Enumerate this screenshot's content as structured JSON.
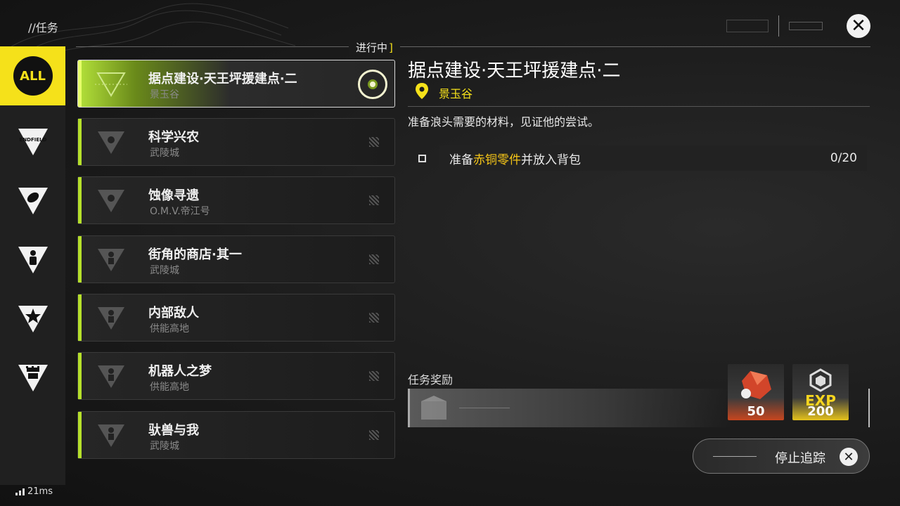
{
  "header": {
    "title": "//任务",
    "close_icon": "close-icon"
  },
  "status": {
    "label": "进行中",
    "bracket": "]"
  },
  "sidebar": {
    "items": [
      {
        "label": "ALL",
        "icon": "all-icon",
        "active": true
      },
      {
        "label": "ENDFIELD",
        "icon": "endfield-triangle-icon",
        "active": false
      },
      {
        "label": "",
        "icon": "leaf-triangle-icon",
        "active": false
      },
      {
        "label": "",
        "icon": "person-triangle-icon",
        "active": false
      },
      {
        "label": "",
        "icon": "star-triangle-icon",
        "active": false
      },
      {
        "label": "",
        "icon": "gear-triangle-icon",
        "active": false
      }
    ]
  },
  "quests": [
    {
      "name": "据点建设·天王坪援建点·二",
      "location": "景玉谷",
      "active": true
    },
    {
      "name": "科学兴农",
      "location": "武陵城",
      "active": false
    },
    {
      "name": "蚀像寻遗",
      "location": "O.M.V.帝江号",
      "active": false
    },
    {
      "name": "街角的商店·其一",
      "location": "武陵城",
      "active": false
    },
    {
      "name": "内部敌人",
      "location": "供能高地",
      "active": false
    },
    {
      "name": "机器人之梦",
      "location": "供能高地",
      "active": false
    },
    {
      "name": "驮兽与我",
      "location": "武陵城",
      "active": false
    }
  ],
  "detail": {
    "title": "据点建设·天王坪援建点·二",
    "location": "景玉谷",
    "description": "准备浪头需要的材料，见证他的尝试。",
    "objective": {
      "prefix": "准备",
      "highlight": "赤铜零件",
      "suffix": "并放入背包",
      "count": "0/20"
    }
  },
  "rewards": {
    "label": "任务奖励",
    "items": [
      {
        "icon": "red-crystal-icon",
        "amount": "50"
      },
      {
        "icon": "exp-icon",
        "label": "EXP",
        "amount": "200"
      }
    ]
  },
  "stop_tracking": {
    "label": "停止追踪"
  },
  "ping": {
    "value": "21ms"
  },
  "colors": {
    "accent_yellow": "#f5e11a",
    "accent_green": "#b6e02b",
    "highlight_orange": "#f5c518"
  }
}
